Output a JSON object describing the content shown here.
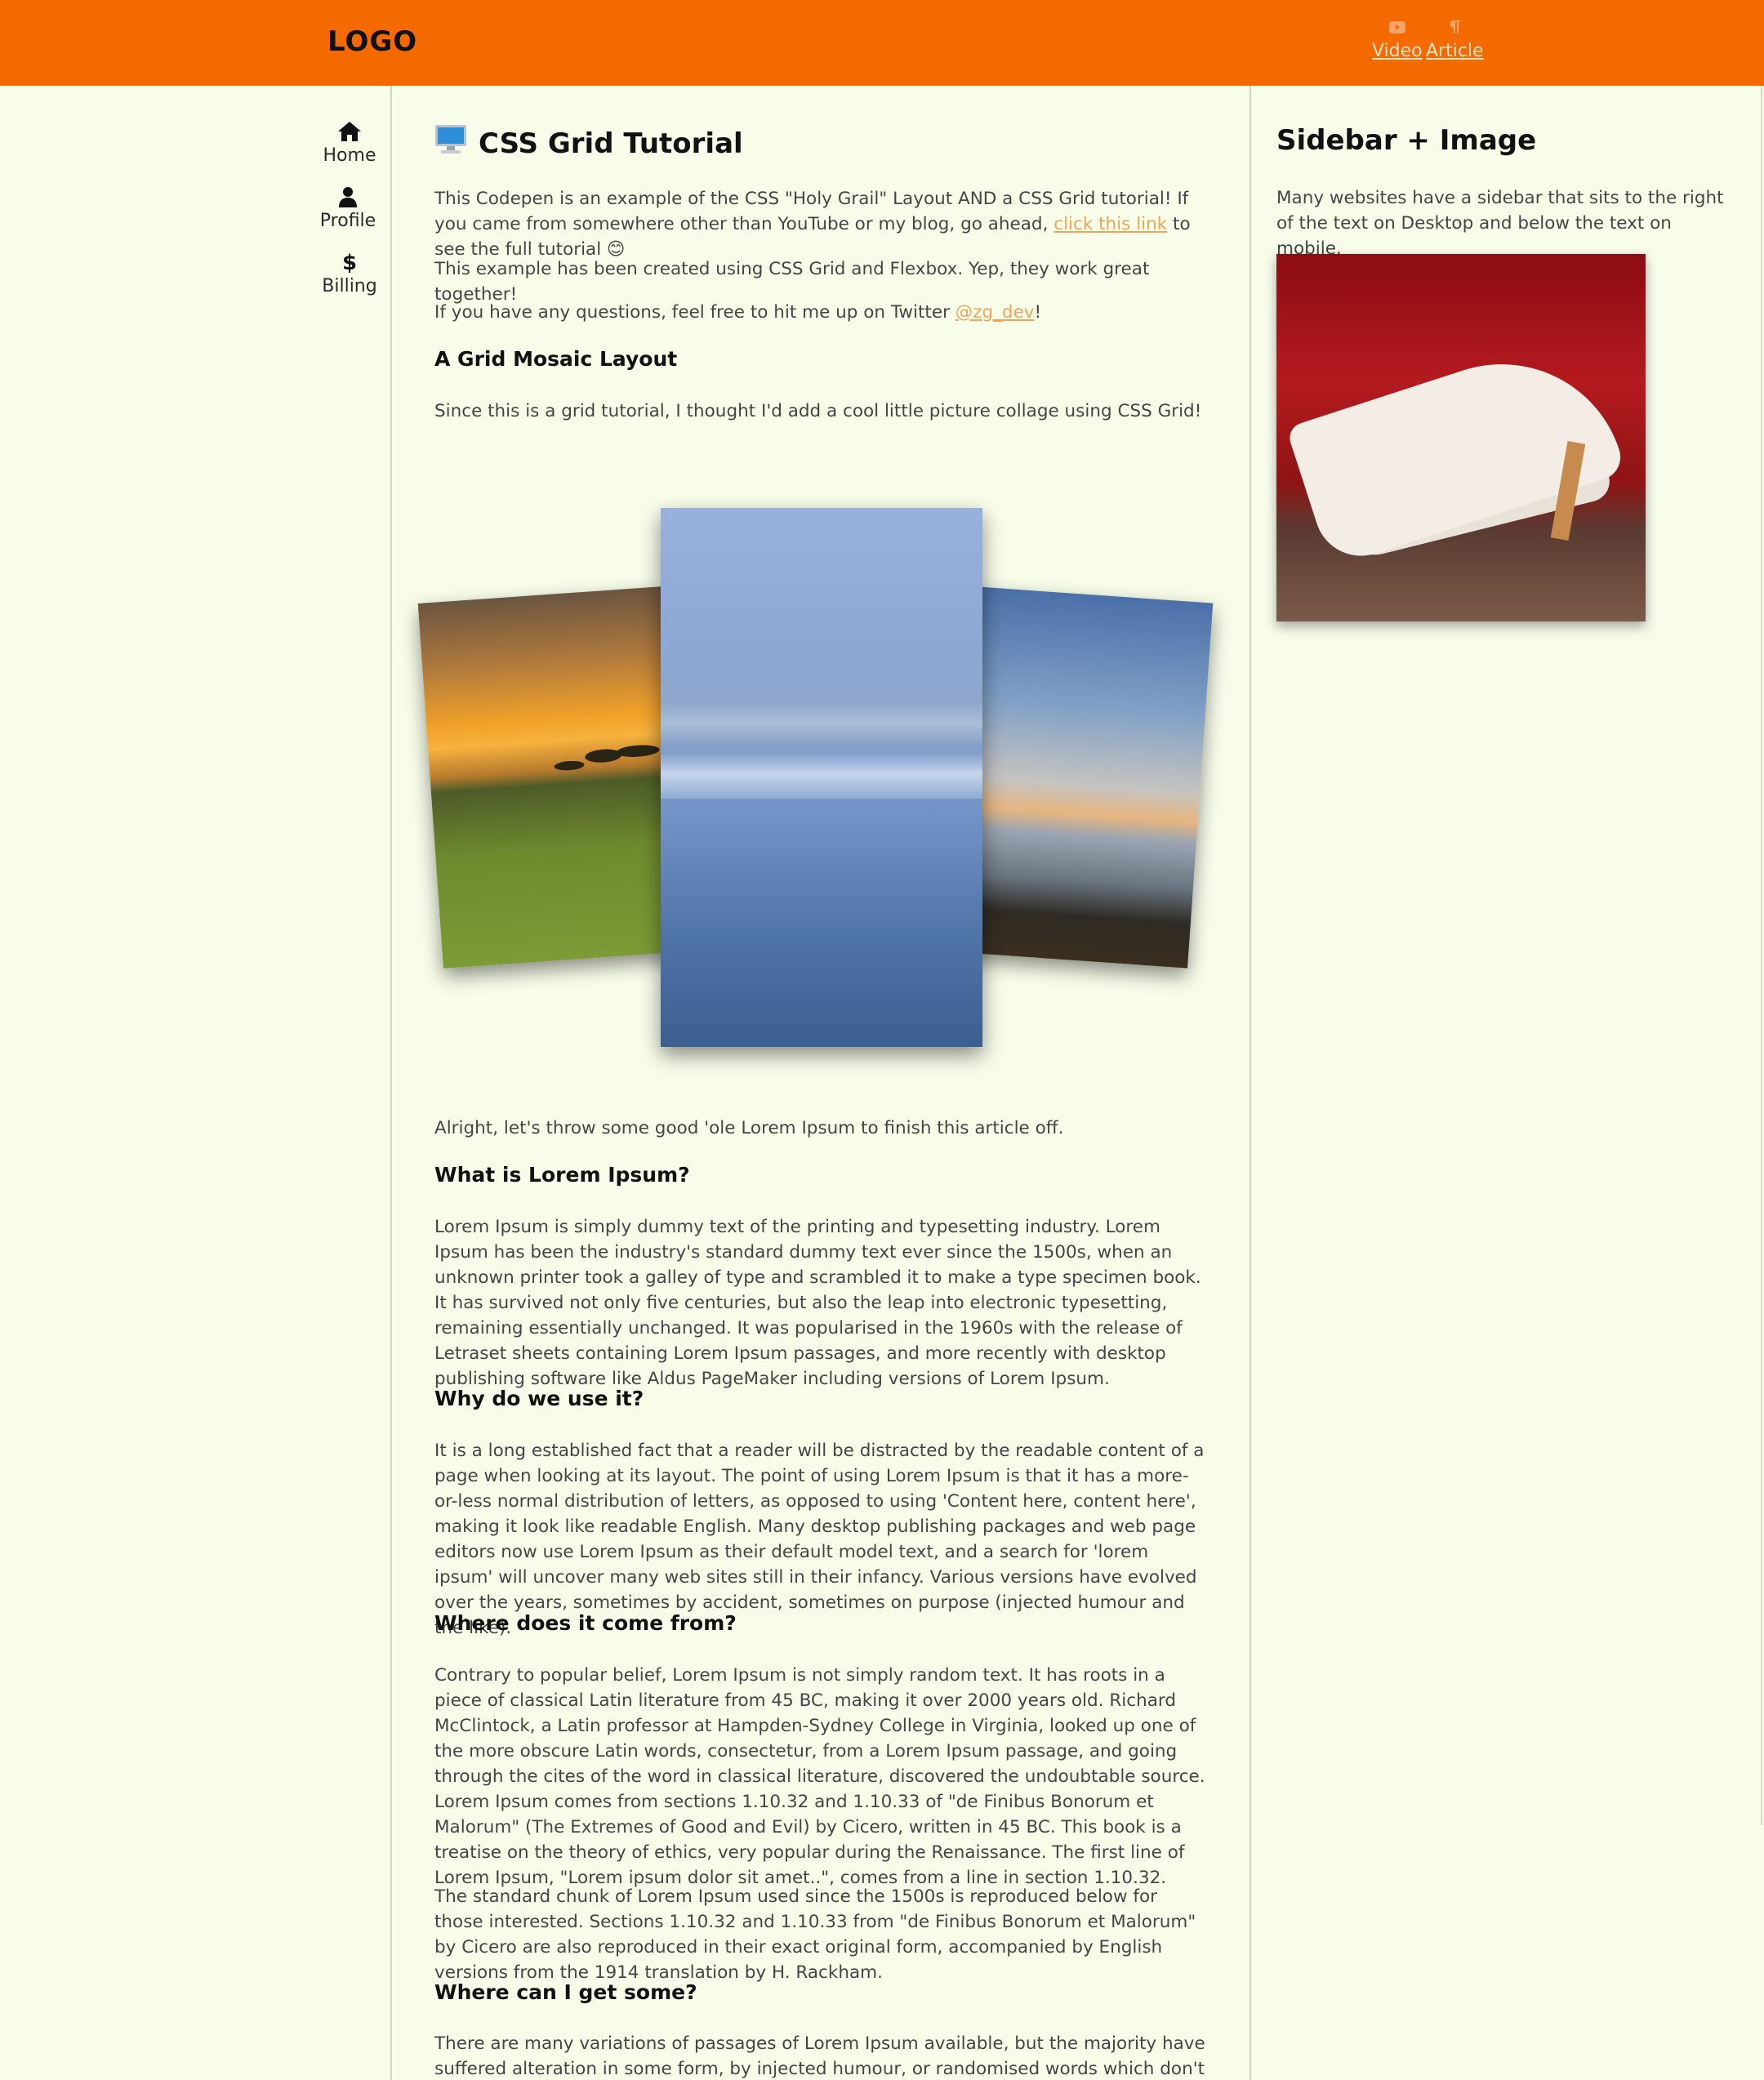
{
  "header": {
    "logo": "LOGO",
    "nav": [
      {
        "label": "Video",
        "icon": "youtube-icon"
      },
      {
        "label": "Article",
        "icon": "paragraph-icon"
      }
    ],
    "background": "#f46a00"
  },
  "sidebar_left": {
    "items": [
      {
        "label": "Home",
        "icon": "home-icon"
      },
      {
        "label": "Profile",
        "icon": "user-icon"
      },
      {
        "label": "Billing",
        "icon": "dollar-icon"
      }
    ]
  },
  "main": {
    "title": "CSS Grid Tutorial",
    "title_icon": "computer-emoji",
    "intro": {
      "p1_before": "This Codepen is an example of the CSS \"Holy Grail\" Layout AND a CSS Grid tutorial! If you came from somewhere other than YouTube or my blog, go ahead, ",
      "p1_link": "click this link",
      "p1_after": " to see the full tutorial 😊",
      "p2": "This example has been created using CSS Grid and Flexbox. Yep, they work great together!",
      "p3_before": "If you have any questions, feel free to hit me up on Twitter ",
      "p3_link": "@zg_dev",
      "p3_after": "!"
    },
    "mosaic": {
      "heading": "A Grid Mosaic Layout",
      "text": "Since this is a grid tutorial, I thought I'd add a cool little picture collage using CSS Grid!"
    },
    "lorem_intro": "Alright, let's throw some good 'ole Lorem Ipsum to finish this article off.",
    "sections": [
      {
        "heading": "What is Lorem Ipsum?",
        "paragraphs": [
          "Lorem Ipsum is simply dummy text of the printing and typesetting industry. Lorem Ipsum has been the industry's standard dummy text ever since the 1500s, when an unknown printer took a galley of type and scrambled it to make a type specimen book. It has survived not only five centuries, but also the leap into electronic typesetting, remaining essentially unchanged. It was popularised in the 1960s with the release of Letraset sheets containing Lorem Ipsum passages, and more recently with desktop publishing software like Aldus PageMaker including versions of Lorem Ipsum."
        ]
      },
      {
        "heading": "Why do we use it?",
        "paragraphs": [
          "It is a long established fact that a reader will be distracted by the readable content of a page when looking at its layout. The point of using Lorem Ipsum is that it has a more-or-less normal distribution of letters, as opposed to using 'Content here, content here', making it look like readable English. Many desktop publishing packages and web page editors now use Lorem Ipsum as their default model text, and a search for 'lorem ipsum' will uncover many web sites still in their infancy. Various versions have evolved over the years, sometimes by accident, sometimes on purpose (injected humour and the like)."
        ]
      },
      {
        "heading": "Where does it come from?",
        "paragraphs": [
          "Contrary to popular belief, Lorem Ipsum is not simply random text. It has roots in a piece of classical Latin literature from 45 BC, making it over 2000 years old. Richard McClintock, a Latin professor at Hampden-Sydney College in Virginia, looked up one of the more obscure Latin words, consectetur, from a Lorem Ipsum passage, and going through the cites of the word in classical literature, discovered the undoubtable source. Lorem Ipsum comes from sections 1.10.32 and 1.10.33 of \"de Finibus Bonorum et Malorum\" (The Extremes of Good and Evil) by Cicero, written in 45 BC. This book is a treatise on the theory of ethics, very popular during the Renaissance. The first line of Lorem Ipsum, \"Lorem ipsum dolor sit amet..\", comes from a line in section 1.10.32.",
          "The standard chunk of Lorem Ipsum used since the 1500s is reproduced below for those interested. Sections 1.10.32 and 1.10.33 from \"de Finibus Bonorum et Malorum\" by Cicero are also reproduced in their exact original form, accompanied by English versions from the 1914 translation by H. Rackham."
        ]
      },
      {
        "heading": "Where can I get some?",
        "paragraphs": [
          "There are many variations of passages of Lorem Ipsum available, but the majority have suffered alteration in some form, by injected humour, or randomised words which don't look even slightly"
        ]
      }
    ]
  },
  "sidebar_right": {
    "title": "Sidebar + Image",
    "text": "Many websites have a sidebar that sits to the right of the text on Desktop and below the text on mobile."
  },
  "colors": {
    "accent": "#f46a00",
    "page_bg": "#f8fdea",
    "link": "#f2a35a"
  }
}
